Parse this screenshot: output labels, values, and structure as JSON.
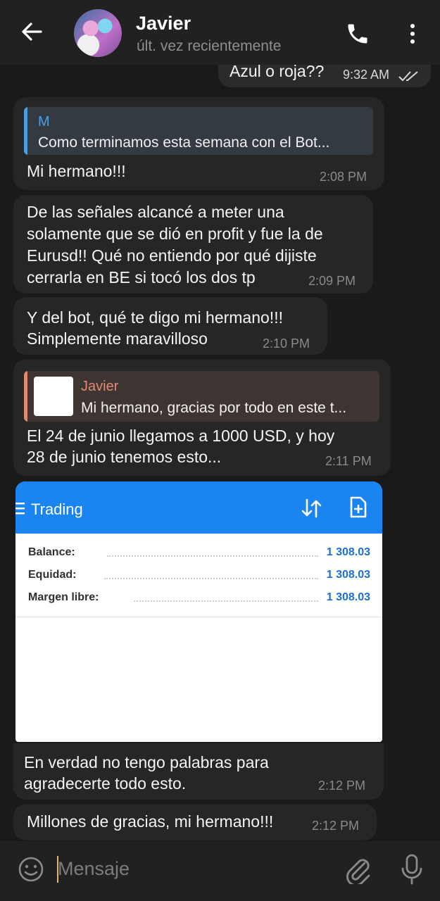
{
  "header": {
    "name": "Javier",
    "status": "últ. vez recientemente"
  },
  "messages": {
    "m0": {
      "text": "Azul o roja??",
      "time": "9:32 AM"
    },
    "m1": {
      "reply_name": "M",
      "reply_text": "Como terminamos esta semana con el Bot...",
      "text": "Mi hermano!!!",
      "time": "2:08 PM"
    },
    "m2": {
      "lines": [
        "De las señales alcancé a meter una",
        "solamente que se dió en profit y fue la de",
        "Eurusd!! Qué no entiendo por qué dijiste",
        "cerrarla en BE si tocó los dos tp"
      ],
      "time": "2:09 PM"
    },
    "m3": {
      "lines": [
        "Y del bot, qué te digo mi hermano!!!",
        "Simplemente maravilloso"
      ],
      "time": "2:10 PM"
    },
    "m4": {
      "reply_name": "Javier",
      "reply_text": "Mi hermano, gracias por todo en este t...",
      "lines": [
        "El 24 de junio llegamos a 1000 USD, y hoy",
        "28 de junio tenemos esto..."
      ],
      "time": "2:11 PM"
    },
    "m5": {
      "lines": [
        "En verdad no tengo palabras para",
        "agradecerte todo esto."
      ],
      "time": "2:12 PM"
    },
    "m6": {
      "text": "Millones de gracias, mi hermano!!!",
      "time": "2:12 PM"
    }
  },
  "screenshot": {
    "title": "Trading",
    "rows": [
      {
        "label": "Balance:",
        "value": "1 308.03"
      },
      {
        "label": "Equidad:",
        "value": "1 308.03"
      },
      {
        "label": "Margen libre:",
        "value": "1 308.03"
      }
    ]
  },
  "input": {
    "placeholder": "Mensaje"
  },
  "colors": {
    "background": "#1a1a1a",
    "bubble": "#262626",
    "reply_accent_blue": "#4a9fe0",
    "reply_accent_salmon": "#e08a72",
    "trading_blue": "#1a84f0"
  }
}
